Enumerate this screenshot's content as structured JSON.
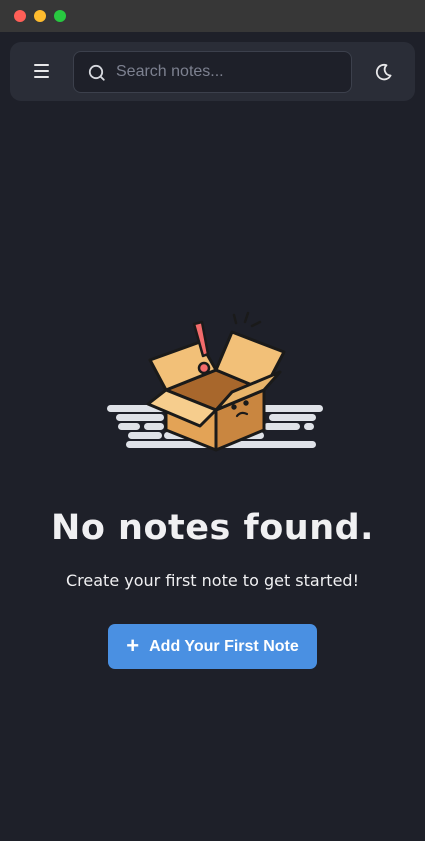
{
  "window": {
    "controls": [
      "close",
      "minimize",
      "maximize"
    ]
  },
  "header": {
    "menu_icon": "menu-icon",
    "search": {
      "placeholder": "Search notes...",
      "value": "",
      "icon": "search-icon"
    },
    "theme_toggle_icon": "moon-icon"
  },
  "empty_state": {
    "illustration": "empty-box-icon",
    "title": "No notes found.",
    "subtitle": "Create your first note to get started!",
    "button": {
      "icon": "plus-icon",
      "icon_glyph": "+",
      "label": "Add Your First Note"
    }
  },
  "colors": {
    "background": "#1e2029",
    "header": "#2a2d37",
    "accent": "#4a90e2",
    "text": "#f0f0f2"
  }
}
